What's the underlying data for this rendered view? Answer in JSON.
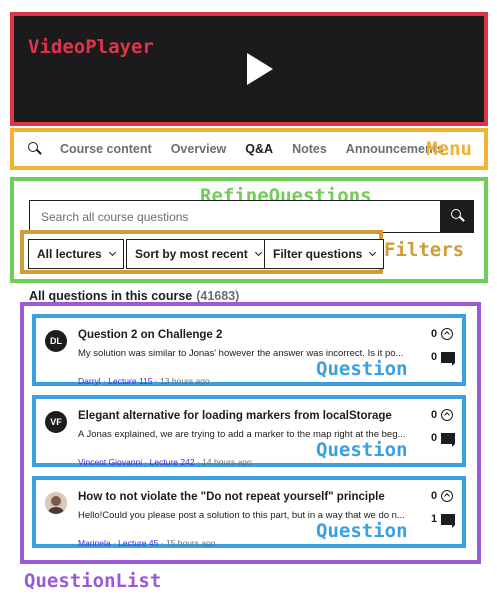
{
  "annotations": {
    "video_player": "VideoPlayer",
    "menu": "Menu",
    "refine_questions": "RefineQuestions",
    "filters": "Filters",
    "question": "Question",
    "question_list": "QuestionList"
  },
  "menu": {
    "tabs": [
      "Course content",
      "Overview",
      "Q&A",
      "Notes",
      "Announcements"
    ],
    "active_tab": "Q&A"
  },
  "search": {
    "placeholder": "Search all course questions"
  },
  "filters": {
    "lectures": "All lectures",
    "sort": "Sort by most recent",
    "questions": "Filter questions"
  },
  "list": {
    "heading": "All questions in this course",
    "count": "(41683)"
  },
  "questions": [
    {
      "avatar": "DL",
      "title": "Question 2 on Challenge 2",
      "body": "My solution was similar to Jonas' however the answer was incorrect. Is it po...",
      "author": "Darryl",
      "lecture": "Lecture 115",
      "time": "13 hours ago",
      "upvotes": "0",
      "answers": "0"
    },
    {
      "avatar": "VF",
      "title": "Elegant alternative for loading markers from localStorage",
      "body": "A Jonas explained, we are trying to add a marker to the map right at the beg...",
      "author": "Vincent Giovanni",
      "lecture": "Lecture 242",
      "time": "14 hours ago",
      "upvotes": "0",
      "answers": "0"
    },
    {
      "avatar": "",
      "title": "How to not violate the \"Do not repeat yourself\" principle",
      "body": "Hello!Could you please post a solution to this part, but in a way that we do n...",
      "author": "Marinela",
      "lecture": "Lecture 45",
      "time": "15 hours ago",
      "upvotes": "0",
      "answers": "1"
    }
  ],
  "colors": {
    "video_box": "#e0344a",
    "menu_box": "#f2b233",
    "refine_box": "#6fce55",
    "filters_box": "#d09c3a",
    "list_box": "#9b59d6",
    "question_box": "#3aa0e0",
    "link": "#5624d0"
  }
}
